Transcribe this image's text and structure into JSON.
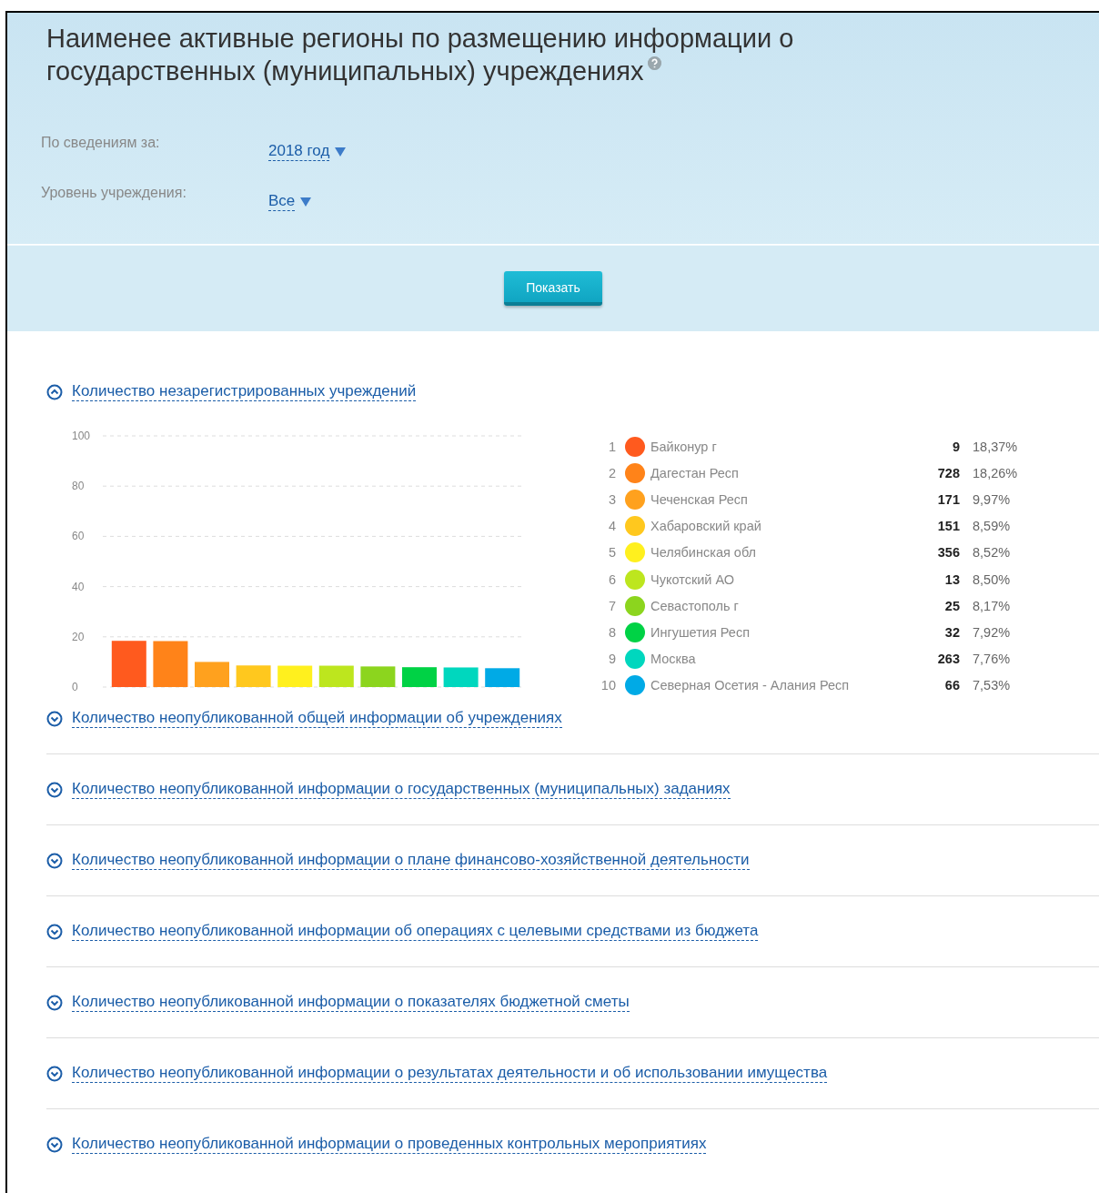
{
  "header": {
    "title": "Наименее активные регионы по размещению информации о государственных (муниципальных) учреждениях",
    "filters": [
      {
        "label": "По сведениям за:",
        "value": "2018 год"
      },
      {
        "label": "Уровень учреждения:",
        "value": "Все"
      }
    ],
    "button": "Показать"
  },
  "sections": [
    {
      "title": "Количество незарегистрированных учреждений",
      "expanded": true,
      "chart_data": {
        "type": "bar",
        "values": [
          18.4,
          18.3,
          10,
          8.6,
          8.5,
          8.5,
          8.2,
          7.9,
          7.8,
          7.5
        ],
        "ylim": [
          0,
          100
        ],
        "yticks": [
          0,
          20,
          40,
          60,
          80,
          100
        ],
        "grid": true
      },
      "legend": [
        {
          "rank": "1",
          "name": "Байконур г",
          "color": "#ff5a1e",
          "count": "9",
          "share": "18,37%"
        },
        {
          "rank": "2",
          "name": "Дагестан Респ",
          "color": "#ff8319",
          "count": "728",
          "share": "18,26%"
        },
        {
          "rank": "3",
          "name": "Чеченская Респ",
          "color": "#ffa11e",
          "count": "171",
          "share": "9,97%"
        },
        {
          "rank": "4",
          "name": "Хабаровский край",
          "color": "#ffc81e",
          "count": "151",
          "share": "8,59%"
        },
        {
          "rank": "5",
          "name": "Челябинская обл",
          "color": "#fff01e",
          "count": "356",
          "share": "8,52%"
        },
        {
          "rank": "6",
          "name": "Чукотский АО",
          "color": "#bde61e",
          "count": "13",
          "share": "8,50%"
        },
        {
          "rank": "7",
          "name": "Севастополь г",
          "color": "#8cd51e",
          "count": "25",
          "share": "8,17%"
        },
        {
          "rank": "8",
          "name": "Ингушетия Респ",
          "color": "#00d245",
          "count": "32",
          "share": "7,92%"
        },
        {
          "rank": "9",
          "name": "Москва",
          "color": "#00d7be",
          "count": "263",
          "share": "7,76%"
        },
        {
          "rank": "10",
          "name": "Северная Осетия - Алания Респ",
          "color": "#00aae6",
          "count": "66",
          "share": "7,53%"
        }
      ]
    },
    {
      "title": "Количество неопубликованной общей информации об учреждениях",
      "expanded": false
    },
    {
      "title": "Количество неопубликованной информации о государственных (муниципальных) заданиях",
      "expanded": false
    },
    {
      "title": "Количество неопубликованной информации о плане финансово-хозяйственной деятельности",
      "expanded": false
    },
    {
      "title": "Количество неопубликованной информации об операциях с целевыми средствами из бюджета",
      "expanded": false
    },
    {
      "title": "Количество неопубликованной информации о показателях бюджетной сметы",
      "expanded": false
    },
    {
      "title": "Количество неопубликованной информации о результатах деятельности и об использовании имущества",
      "expanded": false
    },
    {
      "title": "Количество неопубликованной информации о проведенных контрольных мероприятиях",
      "expanded": false
    }
  ]
}
